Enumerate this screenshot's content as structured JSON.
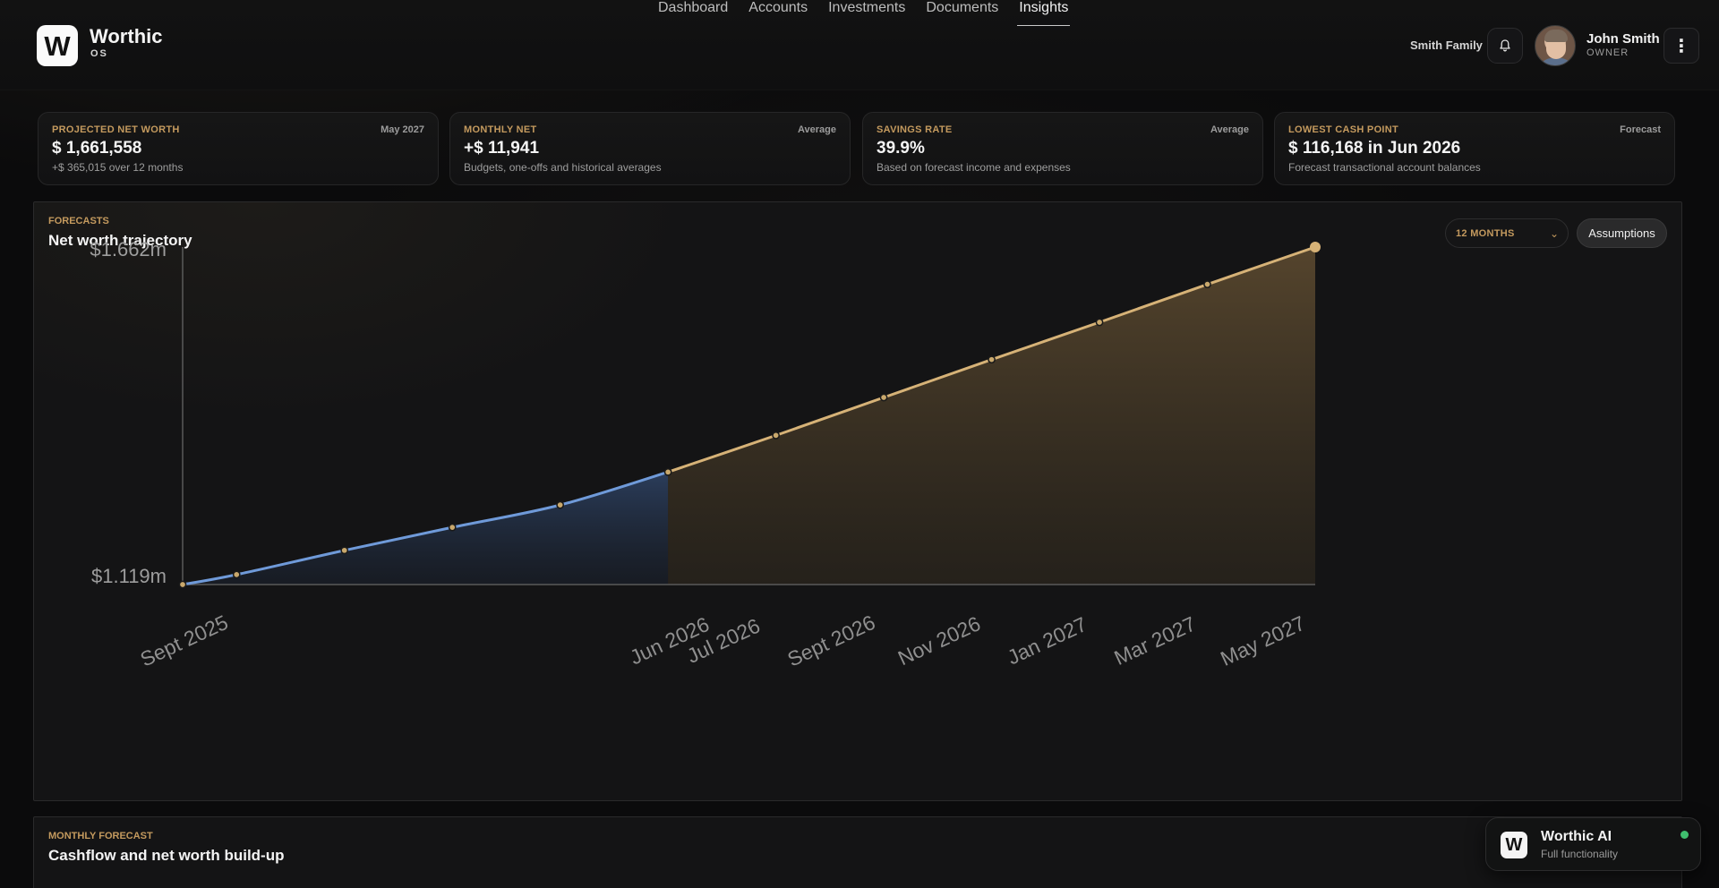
{
  "header": {
    "logo_letter": "W",
    "brand_name": "Worthic",
    "brand_sub": "OS",
    "nav": [
      "Dashboard",
      "Accounts",
      "Investments",
      "Documents",
      "Insights"
    ],
    "active_nav": "Insights",
    "family": "Smith Family",
    "user_name": "John Smith",
    "user_role": "OWNER",
    "menu_glyph": "⋮"
  },
  "cards": [
    {
      "label": "PROJECTED NET WORTH",
      "tag": "May 2027",
      "value": "$ 1,661,558",
      "sub": "+$ 365,015 over 12 months"
    },
    {
      "label": "MONTHLY NET",
      "tag": "Average",
      "value": "+$ 11,941",
      "sub": "Budgets, one-offs and historical averages"
    },
    {
      "label": "SAVINGS RATE",
      "tag": "Average",
      "value": "39.9%",
      "sub": "Based on forecast income and expenses"
    },
    {
      "label": "LOWEST CASH POINT",
      "tag": "Forecast",
      "value": "$ 116,168  in Jun 2026",
      "sub": "Forecast transactional account balances"
    }
  ],
  "panel": {
    "kicker": "FORECASTS",
    "title": "Net worth trajectory",
    "period_select": "12 MONTHS",
    "chevron": "⌄",
    "assumptions_label": "Assumptions"
  },
  "panel2": {
    "kicker": "MONTHLY FORECAST",
    "title": "Cashflow and net worth build-up"
  },
  "ai": {
    "logo_letter": "W",
    "name": "Worthic AI",
    "sub": "Full functionality",
    "status_color": "#3fbf6e"
  },
  "chart_data": {
    "type": "area",
    "ylim": [
      1.119,
      1.662
    ],
    "y_tick_labels": [
      "$1.662m",
      "$1.119m"
    ],
    "x_tick_labels": [
      "Sept 2025",
      "Jun 2026",
      "Jul 2026",
      "Sept 2026",
      "Nov 2026",
      "Jan 2027",
      "Mar 2027",
      "May 2027"
    ],
    "x_tick_months": [
      0,
      9,
      10,
      12,
      14,
      16,
      18,
      20
    ],
    "series": [
      {
        "name": "historical",
        "color": "#6f9ad9",
        "points": [
          [
            0,
            1.119
          ],
          [
            1,
            1.135
          ],
          [
            3,
            1.174
          ],
          [
            5,
            1.211
          ],
          [
            7,
            1.247
          ],
          [
            9,
            1.3
          ]
        ]
      },
      {
        "name": "forecast",
        "color": "#d6b277",
        "points": [
          [
            9,
            1.3
          ],
          [
            11,
            1.359
          ],
          [
            13,
            1.42
          ],
          [
            15,
            1.481
          ],
          [
            17,
            1.541
          ],
          [
            19,
            1.602
          ],
          [
            21,
            1.662
          ]
        ]
      }
    ],
    "grid": false,
    "legend": "none"
  }
}
